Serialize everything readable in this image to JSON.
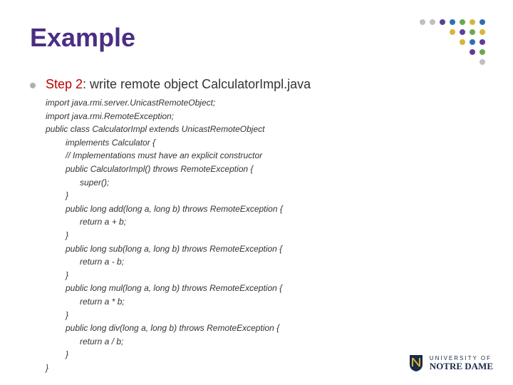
{
  "title": "Example",
  "step": {
    "label": "Step 2",
    "desc": ": write remote object CalculatorImpl.java"
  },
  "code": [
    {
      "indent": 0,
      "text": "import java.rmi.server.UnicastRemoteObject;"
    },
    {
      "indent": 0,
      "text": "import java.rmi.RemoteException;"
    },
    {
      "indent": 0,
      "text": "public class CalculatorImpl extends UnicastRemoteObject"
    },
    {
      "indent": 1,
      "text": "implements Calculator {"
    },
    {
      "indent": 1,
      "text": "// Implementations must have an explicit constructor"
    },
    {
      "indent": 1,
      "text": "public CalculatorImpl() throws RemoteException {"
    },
    {
      "indent": 2,
      "text": "super();"
    },
    {
      "indent": 1,
      "text": "}"
    },
    {
      "indent": 1,
      "text": "public long add(long a, long b) throws RemoteException {"
    },
    {
      "indent": 2,
      "text": " return a + b;"
    },
    {
      "indent": 1,
      "text": "}"
    },
    {
      "indent": 1,
      "text": "public long sub(long a, long b) throws RemoteException {"
    },
    {
      "indent": 2,
      "text": " return a - b;"
    },
    {
      "indent": 1,
      "text": "}"
    },
    {
      "indent": 1,
      "text": "public long mul(long a, long b) throws RemoteException {"
    },
    {
      "indent": 2,
      "text": " return a * b;"
    },
    {
      "indent": 1,
      "text": "}"
    },
    {
      "indent": 1,
      "text": "public long div(long a, long b) throws RemoteException {"
    },
    {
      "indent": 2,
      "text": " return a / b;"
    },
    {
      "indent": 1,
      "text": "}"
    },
    {
      "indent": 0,
      "text": "}"
    }
  ],
  "logo": {
    "top": "UNIVERSITY OF",
    "bottom": "NOTRE DAME"
  },
  "dot_colors": {
    "purple": "#5b3e99",
    "blue": "#2f6fb3",
    "yellow": "#d9b43a",
    "green": "#6aa84f",
    "gray": "#bfbfbf"
  }
}
